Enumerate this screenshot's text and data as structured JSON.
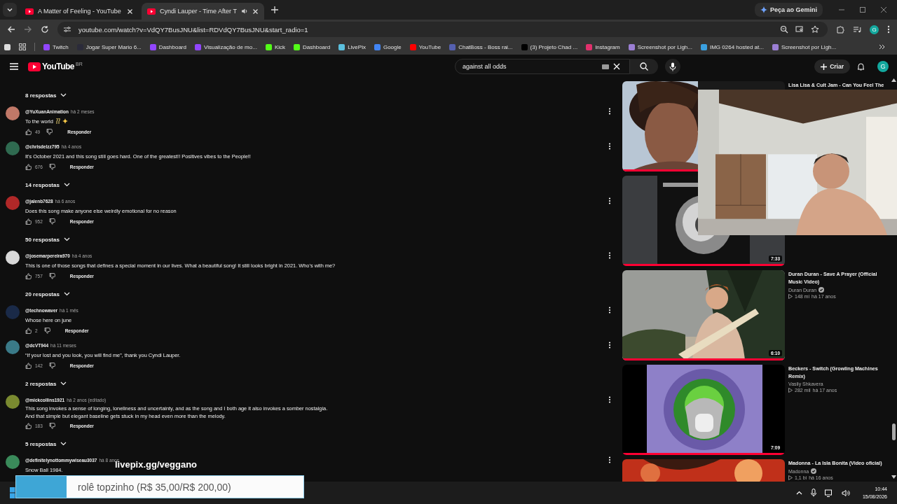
{
  "browser": {
    "tabs": [
      {
        "title": "A Matter of Feeling - YouTube",
        "selected": false,
        "audio": false
      },
      {
        "title": "Cyndi Lauper - Time After T",
        "selected": true,
        "audio": true
      }
    ],
    "gemini_button": "Peça ao Gemini",
    "profile_avatar": "G",
    "address": "youtube.com/watch?v=VdQY7BusJNU&list=RDVdQY7BusJNU&start_radio=1",
    "bookmarks": [
      {
        "label": "Twitch",
        "color": "#9146ff"
      },
      {
        "label": "Jogar Super Mario 6...",
        "color": "#2b2b3a"
      },
      {
        "label": "Dashboard",
        "color": "#9146ff"
      },
      {
        "label": "Visualização de mo...",
        "color": "#9146ff"
      },
      {
        "label": "Kick",
        "color": "#53fc18"
      },
      {
        "label": "Dashboard",
        "color": "#53fc18"
      },
      {
        "label": "LivePix",
        "color": "#5bc0de"
      },
      {
        "label": "Google",
        "color": "#4285f4"
      },
      {
        "label": "YouTube",
        "color": "#ff0000"
      },
      {
        "label": "ChatBoss - Boss rai...",
        "color": "#5560b0"
      },
      {
        "label": "(3) Projeto Chad ...",
        "color": "#000000"
      },
      {
        "label": "Instagram",
        "color": "#e1306c"
      },
      {
        "label": "Screenshot por Ligh...",
        "color": "#9b7fd4"
      },
      {
        "label": "IMG 0264 hosted at...",
        "color": "#3aa0e0"
      },
      {
        "label": "Screenshot por Ligh...",
        "color": "#9b7fd4"
      }
    ]
  },
  "youtube": {
    "logo": "YouTube",
    "country": "BR",
    "search": {
      "value": "against all odds"
    },
    "create_button": "Criar",
    "avatar": "G"
  },
  "thread": [
    {
      "kind": "replies",
      "label": "8 respostas"
    },
    {
      "kind": "comment",
      "author": "@YuXuanAnimation",
      "time": "há 2 meses",
      "text": "To the world",
      "emoji": true,
      "likes": "49",
      "reply": "Responder",
      "color": "#c07868"
    },
    {
      "kind": "comment",
      "author": "@chrisdelzz795",
      "time": "há 4 anos",
      "text": "It's October 2021 and this song still goes hard. One of the greatest!! Positives vibes to the People!!",
      "emoji": false,
      "likes": "676",
      "reply": "Responder",
      "color": "#2f6a50"
    },
    {
      "kind": "replies",
      "label": "14 respostas"
    },
    {
      "kind": "comment",
      "author": "@jalenb7628",
      "time": "há 6 anos",
      "text": "Does this song make anyone else weirdly emotional for no reason",
      "emoji": false,
      "likes": "952",
      "reply": "Responder",
      "color": "#b02828"
    },
    {
      "kind": "replies",
      "label": "50 respostas"
    },
    {
      "kind": "comment",
      "author": "@josemarpereira970",
      "time": "há 4 anos",
      "text": "This is one of those songs that defines a special moment in our lives. What a beautiful song! It still looks bright in 2021. Who's with me?",
      "emoji": false,
      "likes": "757",
      "reply": "Responder",
      "color": "#d8d8d8"
    },
    {
      "kind": "replies",
      "label": "20 respostas"
    },
    {
      "kind": "comment",
      "author": "@technowaver",
      "time": "há 1 mês",
      "text": "Whose here on june",
      "emoji": false,
      "likes": "2",
      "reply": "Responder",
      "color": "#1a2a48"
    },
    {
      "kind": "comment",
      "author": "@dcVT944",
      "time": "há 11 meses",
      "text": "“If your lost and you look, you will find me”, thank you Cyndi Lauper.",
      "emoji": false,
      "likes": "142",
      "reply": "Responder",
      "color": "#3a7a88"
    },
    {
      "kind": "replies",
      "label": "2 respostas"
    },
    {
      "kind": "comment",
      "author": "@mickcollins1921",
      "time": "há 2 anos (editado)",
      "text": "This song invokes a sense of longing, loneliness and uncertainty, and as the song and I both age it also invokes a somber nostalgia.\nAnd that simple but elegant baseline gets stuck in my head even more than the melody.",
      "emoji": false,
      "likes": "183",
      "reply": "Responder",
      "color": "#7a8a30"
    },
    {
      "kind": "replies",
      "label": "5 respostas"
    },
    {
      "kind": "comment",
      "author": "@definitelynottommywiseau3037",
      "time": "há 8 anos",
      "text": "Snow Ball 1984.",
      "emoji": false,
      "color": "#3a8a5a"
    }
  ],
  "recommendations": [
    {
      "kind": "portrait",
      "title": "Lisa Lisa & Cult Jam - Can You Feel The",
      "level": 1
    },
    {
      "kind": "album",
      "duration": "7:33",
      "level": 1
    },
    {
      "kind": "beach",
      "title": "Duran Duran - Save A Prayer (Official Music Video)",
      "channel": "Duran Duran",
      "verified": true,
      "views": "148 mi",
      "age": "há 17 anos",
      "duration": "6:10",
      "level": 1
    },
    {
      "kind": "logo",
      "title": "Beckers - Switch (Growling Machines Remix)",
      "channel": "Vasily Shkavera",
      "verified": false,
      "views": "282 mil",
      "age": "há 17 anos",
      "duration": "7:09",
      "level": 1
    },
    {
      "kind": "red",
      "title": "Madonna - La Isla Bonita (Video oficial)",
      "channel": "Madonna",
      "verified": true,
      "views": "1,1 bi",
      "age": "há 16 anos"
    }
  ],
  "overlay": {
    "link": "livepix.gg/veggano",
    "goal": {
      "label": "rolê topzinho (R$ 35,00/R$ 200,00)",
      "level": 0.175
    }
  },
  "taskbar": {
    "time": "10:44",
    "date": "15/08/2026"
  }
}
